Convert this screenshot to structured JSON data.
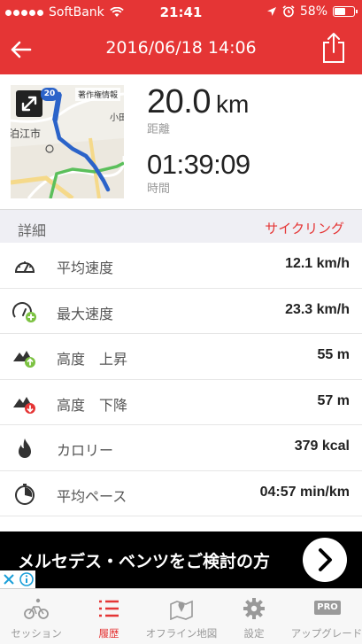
{
  "status_bar": {
    "carrier": "SoftBank",
    "time": "21:41",
    "battery": "58%",
    "battery_level": 0.58
  },
  "nav": {
    "title": "2016/06/18 14:06"
  },
  "map": {
    "route_number": "20",
    "copyright": "著作権情報",
    "place_label": "泊江市",
    "partial_label": "小田"
  },
  "summary": {
    "distance_value": "20.0",
    "distance_unit": "km",
    "distance_label": "距離",
    "time_value": "01:39:09",
    "time_label": "時間"
  },
  "details": {
    "title": "詳細",
    "activity_type": "サイクリング",
    "rows": [
      {
        "label": "平均速度",
        "value": "12.1 km/h",
        "icon": "speedometer-icon"
      },
      {
        "label": "最大速度",
        "value": "23.3 km/h",
        "icon": "max-speed-icon"
      },
      {
        "label": "高度　上昇",
        "value": "55 m",
        "icon": "elevation-up-icon"
      },
      {
        "label": "高度　下降",
        "value": "57 m",
        "icon": "elevation-down-icon"
      },
      {
        "label": "カロリー",
        "value": "379 kcal",
        "icon": "flame-icon"
      },
      {
        "label": "平均ペース",
        "value": "04:57 min/km",
        "icon": "pace-icon"
      }
    ]
  },
  "ad": {
    "text": "メルセデス・ベンツをご検討の方"
  },
  "tabbar": {
    "items": [
      {
        "label": "セッション",
        "icon": "cyclist-icon",
        "active": false
      },
      {
        "label": "履歴",
        "icon": "list-icon",
        "active": true
      },
      {
        "label": "オフライン地図",
        "icon": "map-icon",
        "active": false
      },
      {
        "label": "設定",
        "icon": "gear-icon",
        "active": false
      },
      {
        "label": "アップグレード",
        "icon": "pro-icon",
        "active": false,
        "badge": "PRO"
      }
    ]
  },
  "colors": {
    "accent": "#e53535",
    "route": "#2b63c9",
    "section_bg": "#efeff4"
  }
}
